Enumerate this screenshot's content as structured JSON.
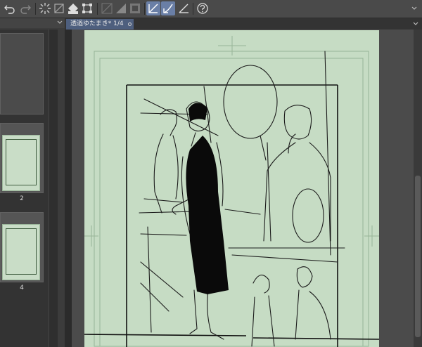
{
  "toolbar": {
    "buttons": [
      {
        "icon": "undo-icon"
      },
      {
        "icon": "redo-icon"
      },
      {
        "icon": "loading-icon"
      },
      {
        "icon": "clear-icon"
      },
      {
        "icon": "fill-icon"
      },
      {
        "icon": "transform-icon"
      },
      {
        "icon": "ruler-icon"
      },
      {
        "icon": "tone-icon"
      },
      {
        "icon": "frame-icon"
      },
      {
        "icon": "ruler-snap-icon",
        "active": true
      },
      {
        "icon": "special-ruler-snap-icon",
        "active": true
      },
      {
        "icon": "perspective-ruler-icon"
      },
      {
        "icon": "help-icon"
      }
    ],
    "accent_color": "#6a7fa6"
  },
  "page_panel": {
    "thumbnails": [
      {
        "label": ""
      },
      {
        "label": "2"
      },
      {
        "label": "4"
      }
    ]
  },
  "canvas": {
    "tab_label": "透過ゆたまき* 1/4",
    "paper_color": "#c6dcc4"
  }
}
